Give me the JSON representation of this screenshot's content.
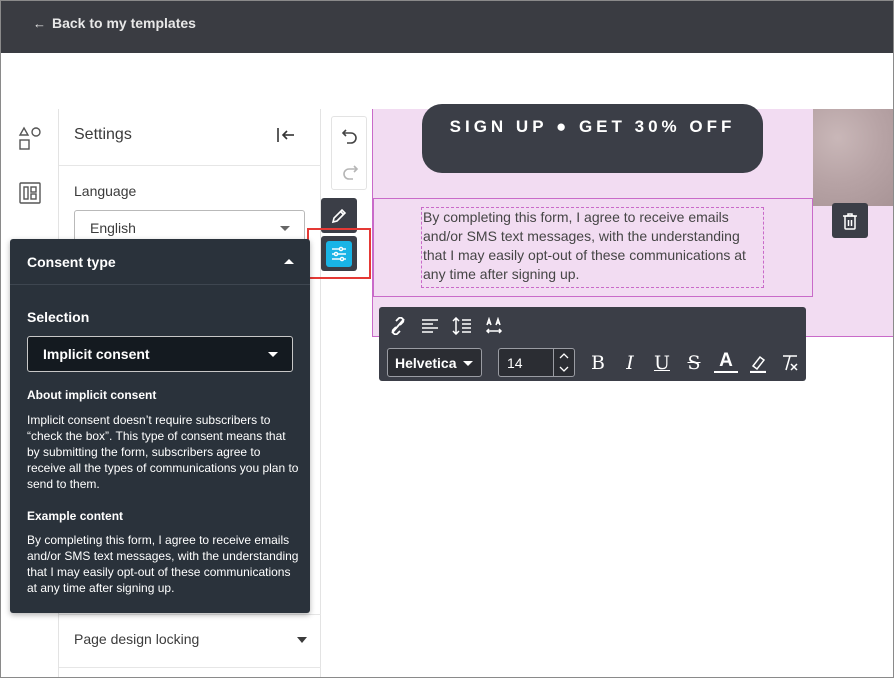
{
  "topbar": {
    "back_label": "Back to my templates"
  },
  "settings": {
    "title": "Settings",
    "language_label": "Language",
    "language_value": "English",
    "page_lock_label": "Page design locking"
  },
  "canvas": {
    "cta_label": "SIGN UP ● GET 30% OFF",
    "consent_text": "By completing this form, I agree to receive emails and/or SMS text messages, with the understanding that I may easily opt-out of these communications at any time after signing up."
  },
  "toolbar": {
    "font_family": "Helvetica",
    "font_size": "14",
    "bold": "B",
    "italic": "I",
    "underline": "U",
    "strike": "S",
    "text_color": "A"
  },
  "popup": {
    "title": "Consent type",
    "selection_label": "Selection",
    "selection_value": "Implicit consent",
    "about_heading": "About implicit consent",
    "about_text": "Implicit consent doesn’t require subscribers to “check the box”. This type of consent means that by submitting the form, subscribers agree to receive all the types of communications you plan to send to them.",
    "example_heading": "Example content",
    "example_text": "By completing this form, I agree to receive emails and/or SMS text messages, with the understanding that I may easily opt-out of these communications at any time after signing up."
  },
  "colors": {
    "topbar": "#3a3c42",
    "canvas_bg": "#f2dcf2",
    "selection_border": "#c96ac9",
    "accent_blue": "#19b4e6",
    "highlight_red": "#e53935",
    "popup_bg": "#2a323b"
  }
}
